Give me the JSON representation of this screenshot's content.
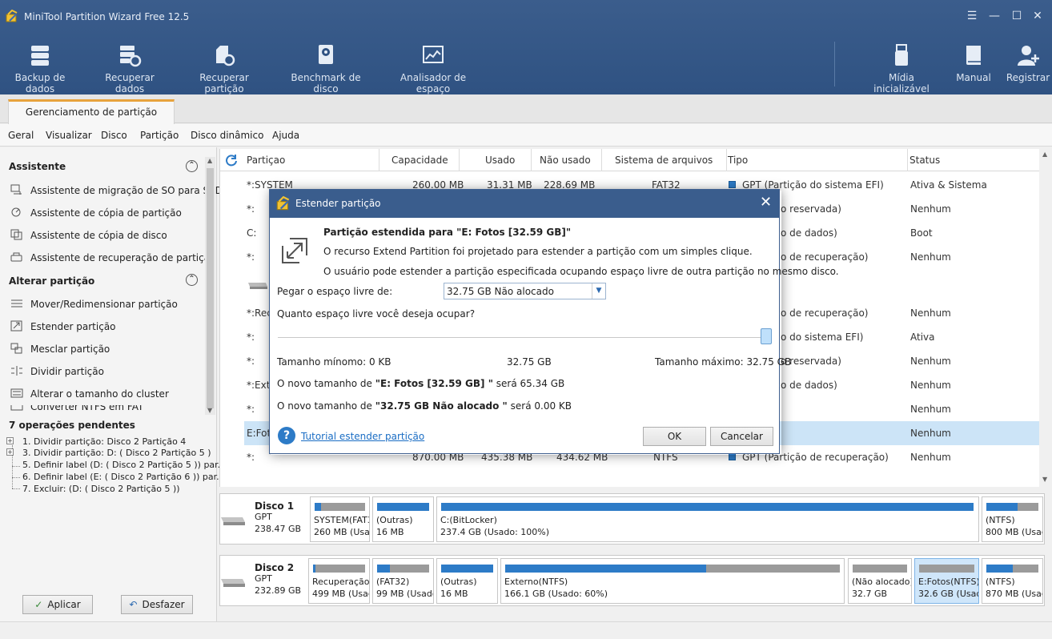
{
  "window": {
    "title": "MiniTool Partition Wizard Free 12.5"
  },
  "toolbar": {
    "items": [
      {
        "label": "Backup de dados",
        "icon": "database-icon"
      },
      {
        "label": "Recuperar dados",
        "icon": "data-recovery-icon"
      },
      {
        "label": "Recuperar partição",
        "icon": "partition-recovery-icon"
      },
      {
        "label": "Benchmark de disco",
        "icon": "benchmark-icon"
      },
      {
        "label": "Analisador de espaço",
        "icon": "space-analyzer-icon"
      },
      {
        "label": "Mídia inicializável",
        "icon": "usb-icon"
      },
      {
        "label": "Manual",
        "icon": "book-icon"
      },
      {
        "label": "Registrar",
        "icon": "add-user-icon"
      }
    ]
  },
  "tabs": [
    {
      "label": "Gerenciamento de partição"
    }
  ],
  "menu": [
    "Geral",
    "Visualizar",
    "Disco",
    "Partição",
    "Disco dinâmico",
    "Ajuda"
  ],
  "sidebar": {
    "assistant": {
      "title": "Assistente",
      "items": [
        "Assistente de migração de SO para SSD",
        "Assistente de cópia de partição",
        "Assistente de cópia de disco",
        "Assistente de recuperação de partição"
      ]
    },
    "change": {
      "title": "Alterar partição",
      "items": [
        "Mover/Redimensionar partição",
        "Estender partição",
        "Mesclar partição",
        "Dividir partição",
        "Alterar o tamanho do cluster",
        "Converter NTFS em FAT"
      ]
    },
    "pending": {
      "title": "7 operações pendentes",
      "ops": [
        "1. Dividir partição: Disco 2 Partição 4",
        "3. Dividir partição: D: ( Disco 2 Partição 5 )",
        "5. Definir label (D: ( Disco 2 Partição 5 )) par...",
        "6. Definir label (E: ( Disco 2 Partição 6 )) par...",
        "7. Excluir: (D: ( Disco 2 Partição 5 ))"
      ]
    },
    "apply_label": "Aplicar",
    "undo_label": "Desfazer"
  },
  "table": {
    "headers": [
      "Partiçao",
      "Capacidade",
      "Usado",
      "Não usado",
      "Sistema de arquivos",
      "Tipo",
      "Status"
    ],
    "rows": [
      {
        "name": "*:SYSTEM",
        "cap": "260.00 MB",
        "used": "31.31 MB",
        "unused": "228.69 MB",
        "fs": "FAT32",
        "type": "GPT (Partição do sistema EFI)",
        "status": "Ativa & Sistema"
      },
      {
        "name": "*:",
        "cap": "",
        "used": "",
        "unused": "",
        "fs": "",
        "type": "tição reservada)",
        "status": "Nenhum"
      },
      {
        "name": "C:",
        "cap": "",
        "used": "",
        "unused": "",
        "fs": "",
        "type": "tição de dados)",
        "status": "Boot"
      },
      {
        "name": "*:",
        "cap": "",
        "used": "",
        "unused": "",
        "fs": "",
        "type": "tição de recuperação)",
        "status": "Nenhum"
      },
      {
        "name": "",
        "cap": "",
        "used": "",
        "unused": "",
        "fs": "",
        "type": "",
        "status": ""
      },
      {
        "name": "*:Rec",
        "cap": "",
        "used": "",
        "unused": "",
        "fs": "",
        "type": "tição de recuperação)",
        "status": "Nenhum"
      },
      {
        "name": "*:",
        "cap": "",
        "used": "",
        "unused": "",
        "fs": "",
        "type": "tição do sistema EFI)",
        "status": "Ativa"
      },
      {
        "name": "*:",
        "cap": "",
        "used": "",
        "unused": "",
        "fs": "",
        "type": "tição reservada)",
        "status": "Nenhum"
      },
      {
        "name": "*:Exte",
        "cap": "",
        "used": "",
        "unused": "",
        "fs": "",
        "type": "tição de dados)",
        "status": "Nenhum"
      },
      {
        "name": "*:",
        "cap": "",
        "used": "",
        "unused": "",
        "fs": "",
        "type": "",
        "status": "Nenhum"
      },
      {
        "name": "E:Foto",
        "cap": "",
        "used": "",
        "unused": "",
        "fs": "",
        "type": "",
        "status": "Nenhum"
      },
      {
        "name": "*:",
        "cap": "870.00 MB",
        "used": "435.38 MB",
        "unused": "434.62 MB",
        "fs": "NTFS",
        "type": "GPT (Partição de recuperação)",
        "status": "Nenhum"
      }
    ]
  },
  "disks": [
    {
      "name": "Disco 1",
      "type": "GPT",
      "size": "238.47 GB",
      "parts": [
        {
          "l1": "SYSTEM(FAT3",
          "l2": "260 MB (Usac",
          "usage": 0.12
        },
        {
          "l1": "(Outras)",
          "l2": "16 MB",
          "usage": 1.0
        },
        {
          "l1": "C:(BitLocker)",
          "l2": "237.4 GB (Usado: 100%)",
          "usage": 1.0
        },
        {
          "l1": "(NTFS)",
          "l2": "800 MB (Usac",
          "usage": 0.6
        }
      ]
    },
    {
      "name": "Disco 2",
      "type": "GPT",
      "size": "232.89 GB",
      "parts": [
        {
          "l1": "Recuperação",
          "l2": "499 MB (Usac",
          "usage": 0.05
        },
        {
          "l1": "(FAT32)",
          "l2": "99 MB (Usado",
          "usage": 0.25
        },
        {
          "l1": "(Outras)",
          "l2": "16 MB",
          "usage": 1.0
        },
        {
          "l1": "Externo(NTFS)",
          "l2": "166.1 GB (Usado: 60%)",
          "usage": 0.6
        },
        {
          "l1": "(Não alocado)",
          "l2": "32.7 GB",
          "usage": 0
        },
        {
          "l1": "E:Fotos(NTFS)",
          "l2": "32.6 GB (Usad",
          "usage": 0
        },
        {
          "l1": "(NTFS)",
          "l2": "870 MB (Usac",
          "usage": 0.5
        }
      ]
    }
  ],
  "dialog": {
    "title": "Estender partição",
    "heading": "Partição estendida para \"E: Fotos [32.59 GB]\"",
    "desc1": "O recurso Extend Partition foi projetado para estender a partição com um simples clique.",
    "desc2": "O usuário pode estender a partição especificada ocupando espaço livre de outra partição no mesmo disco.",
    "take_label": "Pegar o espaço livre de:",
    "take_value": "32.75 GB Não alocado",
    "how_much": "Quanto espaço livre você deseja ocupar?",
    "slider_fraction": 1.0,
    "min_label": "Tamanho mínomo: 0 KB",
    "mid_label": "32.75 GB",
    "max_label": "Tamanho máximo: 32.75 GB",
    "new1_pre": "O novo tamanho de ",
    "new1_bold": "\"E: Fotos [32.59 GB] \"",
    "new1_post": " será 65.34 GB",
    "new2_pre": "O novo tamanho de ",
    "new2_bold": "\"32.75 GB Não alocado \"",
    "new2_post": " será 0.00 KB",
    "tutorial": "Tutorial estender partição",
    "ok": "OK",
    "cancel": "Cancelar"
  },
  "colors": {
    "titlebar": "#3a5d8d",
    "accent": "#2d7bc7",
    "tab_accent": "#e8a33d",
    "selection": "#cce4f7"
  }
}
